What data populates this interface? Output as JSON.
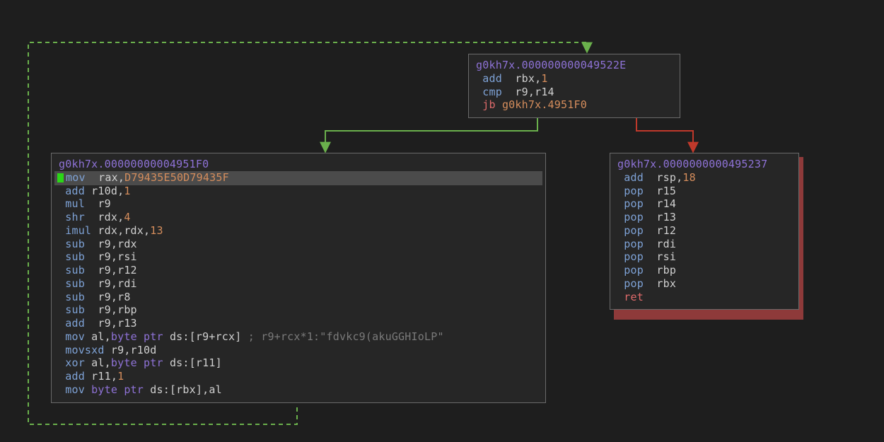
{
  "colors": {
    "bg": "#1e1e1e",
    "node_bg": "#262626",
    "node_border": "#6a6a6a",
    "addr": "#8e72d6",
    "mnemonic": "#7ea2d6",
    "register": "#d0d0d0",
    "immediate": "#d58d5c",
    "jump": "#e06b6b",
    "highlight": "#4b4b4b",
    "ip_marker": "#2bd617",
    "edge_true": "#6ab04c",
    "edge_false": "#c0392b",
    "edge_back": "#6ab04c",
    "red_shadow": "#8e3a3a"
  },
  "node1": {
    "address": "g0kh7x.000000000049522E",
    "lines": [
      {
        "mn": "add",
        "args": "rbx,",
        "tail_num": "1"
      },
      {
        "mn": "cmp",
        "args": "r9,r14"
      }
    ],
    "branch": {
      "mn": "jb",
      "target": "g0kh7x.4951F0"
    }
  },
  "node2": {
    "address": "g0kh7x.00000000004951F0",
    "highlight_line_index": 0,
    "lines": [
      {
        "ip": true,
        "mn": "mov",
        "plain_args": "rax,",
        "imm": "D79435E50D79435F"
      },
      {
        "mn": "add",
        "plain_args": "r10d,",
        "imm": "1"
      },
      {
        "mn": "mul",
        "plain_args": "r9"
      },
      {
        "mn": "shr",
        "plain_args": "rdx,",
        "imm": "4"
      },
      {
        "mn": "imul",
        "plain_args": "rdx,rdx,",
        "imm": "13"
      },
      {
        "mn": "sub",
        "plain_args": "r9,rdx"
      },
      {
        "mn": "sub",
        "plain_args": "r9,rsi"
      },
      {
        "mn": "sub",
        "plain_args": "r9,r12"
      },
      {
        "mn": "sub",
        "plain_args": "r9,rdi"
      },
      {
        "mn": "sub",
        "plain_args": "r9,r8"
      },
      {
        "mn": "sub",
        "plain_args": "r9,rbp"
      },
      {
        "mn": "add",
        "plain_args": "r9,r13"
      },
      {
        "mn": "mov",
        "mem_args": "al,byte ptr ds:[r9+rcx]",
        "comment": " ; r9+rcx*1:\"fdvkc9(akuGGHIoLP\""
      },
      {
        "mn": "movsxd",
        "plain_args": "r9,r10d"
      },
      {
        "mn": "xor",
        "mem_args": "al,byte ptr ds:[r11]"
      },
      {
        "mn": "add",
        "plain_args": "r11,",
        "imm": "1"
      },
      {
        "mn": "mov",
        "mem_args2": "byte ptr ds:[rbx],al"
      }
    ]
  },
  "node3": {
    "address": "g0kh7x.0000000000495237",
    "lines": [
      {
        "mn": "add",
        "plain_args": "rsp,",
        "imm": "18"
      },
      {
        "mn": "pop",
        "plain_args": "r15"
      },
      {
        "mn": "pop",
        "plain_args": "r14"
      },
      {
        "mn": "pop",
        "plain_args": "r13"
      },
      {
        "mn": "pop",
        "plain_args": "r12"
      },
      {
        "mn": "pop",
        "plain_args": "rdi"
      },
      {
        "mn": "pop",
        "plain_args": "rsi"
      },
      {
        "mn": "pop",
        "plain_args": "rbp"
      },
      {
        "mn": "pop",
        "plain_args": "rbx"
      }
    ],
    "ret": "ret"
  },
  "edges": {
    "true_branch": {
      "from": "node1",
      "to": "node2",
      "color": "#6ab04c"
    },
    "false_branch": {
      "from": "node1",
      "to": "node3",
      "color": "#c0392b"
    },
    "back_edge": {
      "from": "node2",
      "to": "node1",
      "color": "#6ab04c",
      "dashed": true
    }
  }
}
